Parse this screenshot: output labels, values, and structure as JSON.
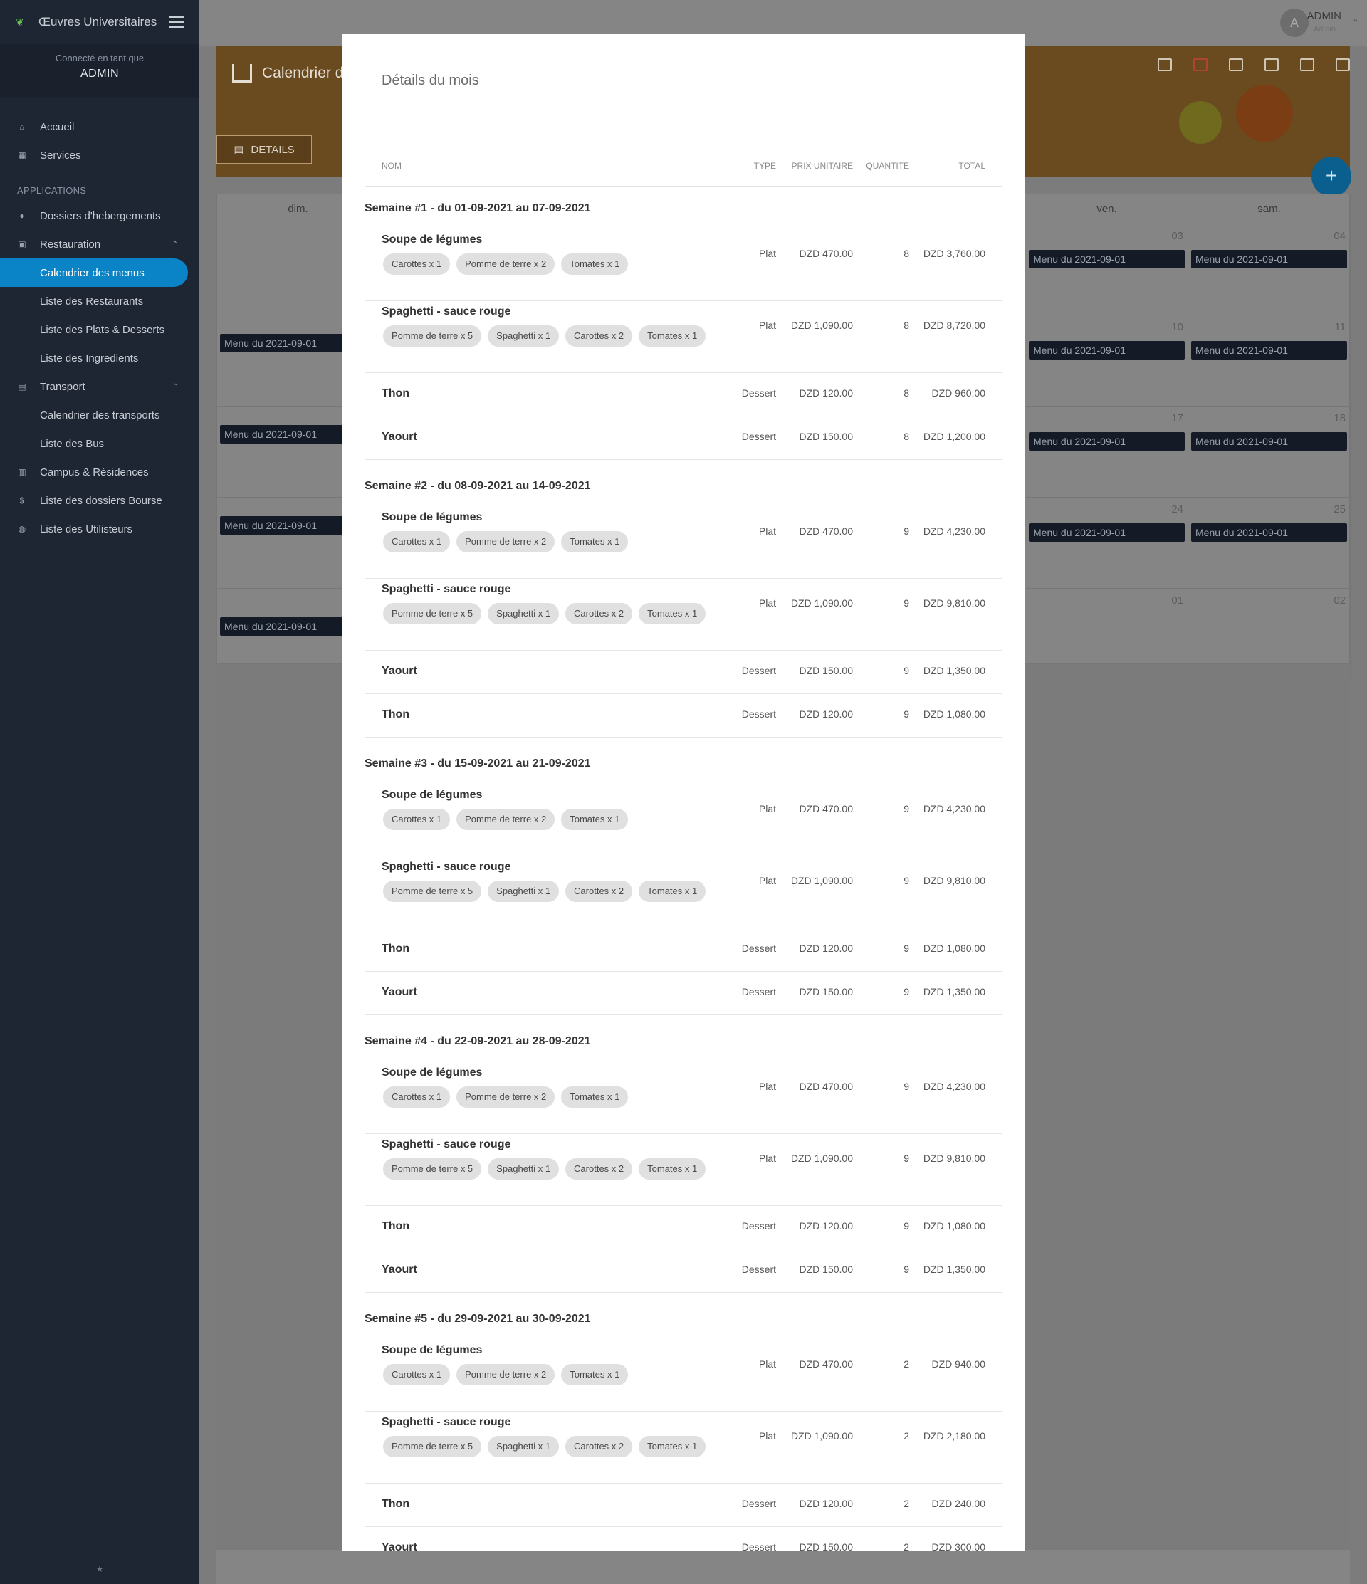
{
  "sidebar": {
    "brand": "Œuvres Universitaires",
    "connected_label": "Connecté en tant que",
    "user_name": "ADMIN",
    "main_items": [
      {
        "label": "Accueil",
        "icon": "home-icon"
      },
      {
        "label": "Services",
        "icon": "grid-icon"
      }
    ],
    "section_title": "APPLICATIONS",
    "app_items": [
      {
        "label": "Dossiers d'hebergements",
        "icon": "user-icon",
        "sub": false,
        "active": false
      },
      {
        "label": "Restauration",
        "icon": "restaurant-icon",
        "sub": false,
        "active": false,
        "expanded": true
      },
      {
        "label": "Calendrier des menus",
        "sub": true,
        "active": true
      },
      {
        "label": "Liste des Restaurants",
        "sub": true,
        "active": false
      },
      {
        "label": "Liste des Plats & Desserts",
        "sub": true,
        "active": false
      },
      {
        "label": "Liste des Ingredients",
        "sub": true,
        "active": false
      },
      {
        "label": "Transport",
        "icon": "bus-icon",
        "sub": false,
        "active": false,
        "expanded": true
      },
      {
        "label": "Calendrier des transports",
        "sub": true,
        "active": false
      },
      {
        "label": "Liste des Bus",
        "sub": true,
        "active": false
      },
      {
        "label": "Campus & Résidences",
        "icon": "building-icon",
        "sub": false,
        "active": false
      },
      {
        "label": "Liste des dossiers Bourse",
        "icon": "dollar-icon",
        "sub": false,
        "active": false
      },
      {
        "label": "Liste des Utilisteurs",
        "icon": "users-icon",
        "sub": false,
        "active": false
      }
    ]
  },
  "topbar": {
    "avatar_letter": "A",
    "user_name": "ADMIN",
    "user_role": "Admin"
  },
  "hero": {
    "title": "Calendrier des",
    "details_button": "DETAILS"
  },
  "calendar": {
    "days": [
      "dim.",
      "ven.",
      "sam."
    ],
    "event_label": "Menu du 2021-09-01",
    "rows": [
      {
        "fri": "03",
        "sat": "04",
        "sun_event": false
      },
      {
        "fri": "10",
        "sat": "11",
        "sun_event": true
      },
      {
        "fri": "17",
        "sat": "18",
        "sun_event": true
      },
      {
        "fri": "24",
        "sat": "25",
        "sun_event": true
      },
      {
        "fri": "01",
        "sat": "02",
        "sun_event": true
      }
    ]
  },
  "modal": {
    "title": "Détails du mois",
    "columns": {
      "nom": "NOM",
      "type": "TYPE",
      "prix": "PRIX UNITAIRE",
      "quantite": "QUANTITE",
      "total": "TOTAL"
    },
    "weeks": [
      {
        "title": "Semaine #1 - du 01-09-2021 au 07-09-2021",
        "items": [
          {
            "name": "Soupe de légumes",
            "type": "Plat",
            "price": "DZD 470.00",
            "qty": "8",
            "total": "DZD 3,760.00",
            "ingredients": [
              "Carottes x 1",
              "Pomme de terre x 2",
              "Tomates x 1"
            ]
          },
          {
            "name": "Spaghetti - sauce rouge",
            "type": "Plat",
            "price": "DZD 1,090.00",
            "qty": "8",
            "total": "DZD 8,720.00",
            "ingredients": [
              "Pomme de terre x 5",
              "Spaghetti x 1",
              "Carottes x 2",
              "Tomates x 1"
            ]
          },
          {
            "name": "Thon",
            "type": "Dessert",
            "price": "DZD 120.00",
            "qty": "8",
            "total": "DZD 960.00",
            "ingredients": []
          },
          {
            "name": "Yaourt",
            "type": "Dessert",
            "price": "DZD 150.00",
            "qty": "8",
            "total": "DZD 1,200.00",
            "ingredients": []
          }
        ]
      },
      {
        "title": "Semaine #2 - du 08-09-2021 au 14-09-2021",
        "items": [
          {
            "name": "Soupe de légumes",
            "type": "Plat",
            "price": "DZD 470.00",
            "qty": "9",
            "total": "DZD 4,230.00",
            "ingredients": [
              "Carottes x 1",
              "Pomme de terre x 2",
              "Tomates x 1"
            ]
          },
          {
            "name": "Spaghetti - sauce rouge",
            "type": "Plat",
            "price": "DZD 1,090.00",
            "qty": "9",
            "total": "DZD 9,810.00",
            "ingredients": [
              "Pomme de terre x 5",
              "Spaghetti x 1",
              "Carottes x 2",
              "Tomates x 1"
            ]
          },
          {
            "name": "Yaourt",
            "type": "Dessert",
            "price": "DZD 150.00",
            "qty": "9",
            "total": "DZD 1,350.00",
            "ingredients": []
          },
          {
            "name": "Thon",
            "type": "Dessert",
            "price": "DZD 120.00",
            "qty": "9",
            "total": "DZD 1,080.00",
            "ingredients": []
          }
        ]
      },
      {
        "title": "Semaine #3 - du 15-09-2021 au 21-09-2021",
        "items": [
          {
            "name": "Soupe de légumes",
            "type": "Plat",
            "price": "DZD 470.00",
            "qty": "9",
            "total": "DZD 4,230.00",
            "ingredients": [
              "Carottes x 1",
              "Pomme de terre x 2",
              "Tomates x 1"
            ]
          },
          {
            "name": "Spaghetti - sauce rouge",
            "type": "Plat",
            "price": "DZD 1,090.00",
            "qty": "9",
            "total": "DZD 9,810.00",
            "ingredients": [
              "Pomme de terre x 5",
              "Spaghetti x 1",
              "Carottes x 2",
              "Tomates x 1"
            ]
          },
          {
            "name": "Thon",
            "type": "Dessert",
            "price": "DZD 120.00",
            "qty": "9",
            "total": "DZD 1,080.00",
            "ingredients": []
          },
          {
            "name": "Yaourt",
            "type": "Dessert",
            "price": "DZD 150.00",
            "qty": "9",
            "total": "DZD 1,350.00",
            "ingredients": []
          }
        ]
      },
      {
        "title": "Semaine #4 - du 22-09-2021 au 28-09-2021",
        "items": [
          {
            "name": "Soupe de légumes",
            "type": "Plat",
            "price": "DZD 470.00",
            "qty": "9",
            "total": "DZD 4,230.00",
            "ingredients": [
              "Carottes x 1",
              "Pomme de terre x 2",
              "Tomates x 1"
            ]
          },
          {
            "name": "Spaghetti - sauce rouge",
            "type": "Plat",
            "price": "DZD 1,090.00",
            "qty": "9",
            "total": "DZD 9,810.00",
            "ingredients": [
              "Pomme de terre x 5",
              "Spaghetti x 1",
              "Carottes x 2",
              "Tomates x 1"
            ]
          },
          {
            "name": "Thon",
            "type": "Dessert",
            "price": "DZD 120.00",
            "qty": "9",
            "total": "DZD 1,080.00",
            "ingredients": []
          },
          {
            "name": "Yaourt",
            "type": "Dessert",
            "price": "DZD 150.00",
            "qty": "9",
            "total": "DZD 1,350.00",
            "ingredients": []
          }
        ]
      },
      {
        "title": "Semaine #5 - du 29-09-2021 au 30-09-2021",
        "items": [
          {
            "name": "Soupe de légumes",
            "type": "Plat",
            "price": "DZD 470.00",
            "qty": "2",
            "total": "DZD 940.00",
            "ingredients": [
              "Carottes x 1",
              "Pomme de terre x 2",
              "Tomates x 1"
            ]
          },
          {
            "name": "Spaghetti - sauce rouge",
            "type": "Plat",
            "price": "DZD 1,090.00",
            "qty": "2",
            "total": "DZD 2,180.00",
            "ingredients": [
              "Pomme de terre x 5",
              "Spaghetti x 1",
              "Carottes x 2",
              "Tomates x 1"
            ]
          },
          {
            "name": "Thon",
            "type": "Dessert",
            "price": "DZD 120.00",
            "qty": "2",
            "total": "DZD 240.00",
            "ingredients": []
          },
          {
            "name": "Yaourt",
            "type": "Dessert",
            "price": "DZD 150.00",
            "qty": "2",
            "total": "DZD 300.00",
            "ingredients": []
          }
        ]
      }
    ]
  },
  "colors": {
    "sidebar_bg": "#1e2533",
    "accent": "#0a84c6",
    "event_bg": "#151b26",
    "chip_bg": "#e0e0e0"
  }
}
